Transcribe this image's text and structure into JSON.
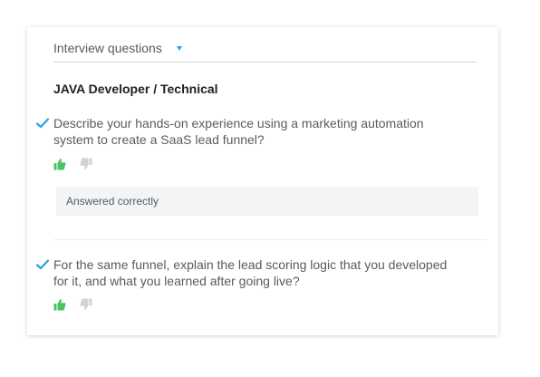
{
  "header": {
    "title": "Interview questions",
    "caret_icon": "caret-down-icon",
    "accent_color": "#2e9fe3"
  },
  "job_title": "JAVA Developer / Technical",
  "questions": [
    {
      "status_icon": "checkmark-icon",
      "text": "Describe your hands-on experience using a marketing automation system to create a SaaS lead funnel?",
      "rating": "thumbs-up",
      "answer_note": "Answered correctly"
    },
    {
      "status_icon": "checkmark-icon",
      "text": "For the same funnel, explain the lead scoring logic that you developed for it, and what you learned after going live?",
      "rating": "thumbs-up"
    }
  ],
  "colors": {
    "check": "#2e9fe3",
    "thumb_up_active": "#4cc265",
    "thumb_down_inactive": "#cfd3d6",
    "answer_bg": "#f3f4f5"
  }
}
